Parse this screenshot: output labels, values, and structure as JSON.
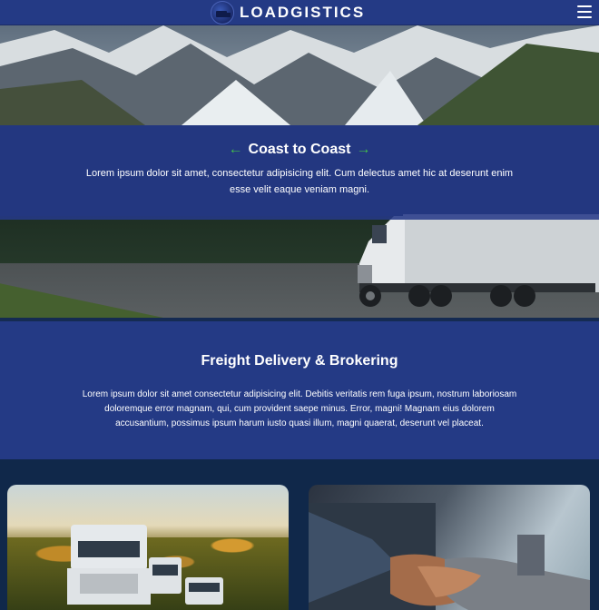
{
  "header": {
    "brand": "LOADGISTICS",
    "logo_icon": "truck-globe-logo",
    "menu_icon": "hamburger-menu-icon"
  },
  "hero": {
    "title": "Coast to Coast",
    "left_arrow": "←",
    "right_arrow": "→",
    "text": "Lorem ipsum dolor sit amet, consectetur adipisicing elit. Cum delectus amet hic at deserunt enim esse velit eaque veniam magni."
  },
  "section": {
    "title": "Freight Delivery & Brokering",
    "text": "Lorem ipsum dolor sit amet consectetur adipisicing elit. Debitis veritatis rem fuga ipsum, nostrum laboriosam doloremque error magnam, qui, cum provident saepe minus. Error, magni! Magnam eius dolorem accusantium, possimus ipsum harum iusto quasi illum, magni quaerat, deserunt vel placeat."
  },
  "colors": {
    "header_bg": "#243a85",
    "band_bg": "#253987",
    "section_bg": "#243a85",
    "page_bg": "#10284a",
    "arrow_green": "#43c04a"
  }
}
